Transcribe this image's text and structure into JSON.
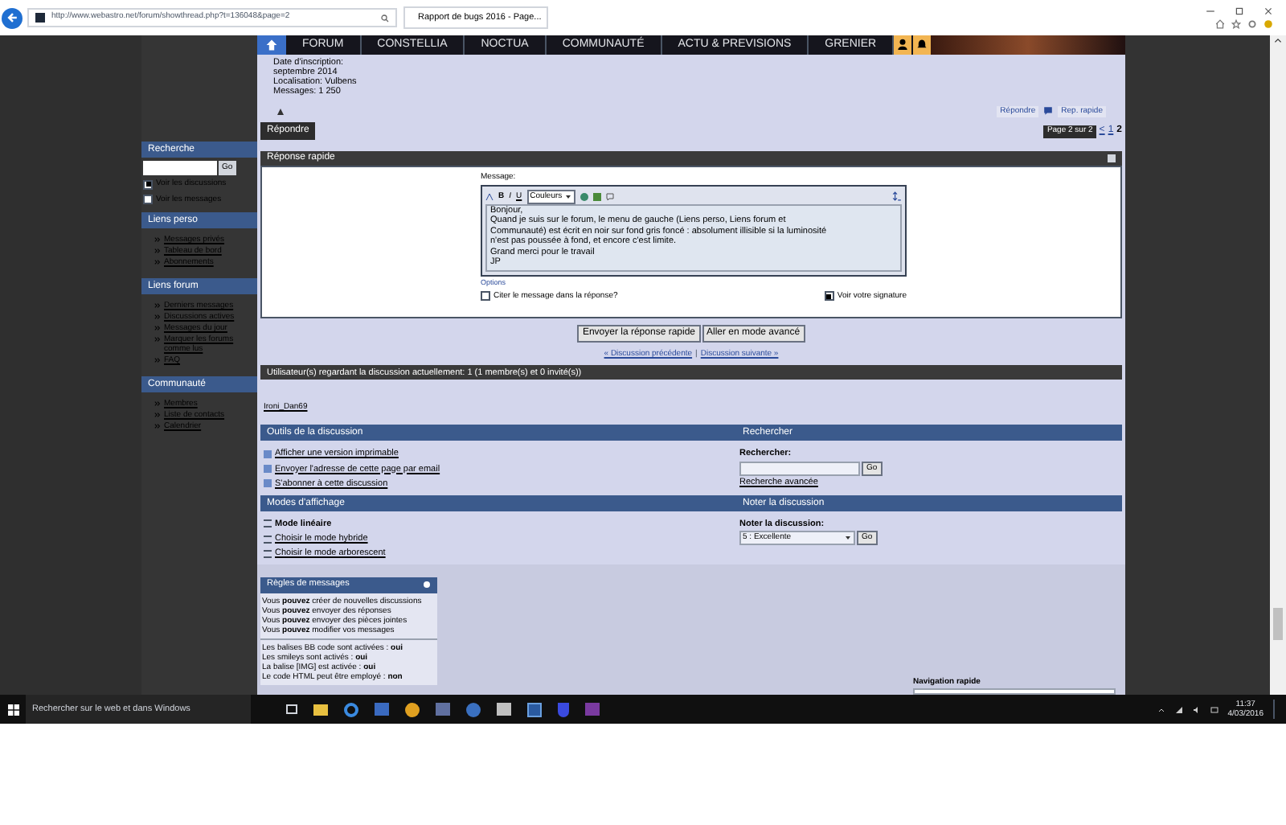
{
  "browser": {
    "url": "http://www.webastro.net/forum/showthread.php?t=136048&page=2",
    "tab_title": "Rapport de bugs 2016 - Page..."
  },
  "nav": {
    "items": [
      "FORUM",
      "CONSTELLIA",
      "NOCTUA",
      "COMMUNAUTÉ",
      "ACTU & PREVISIONS",
      "GRENIER"
    ]
  },
  "sidebar": {
    "search": {
      "title": "Recherche",
      "button": "Go",
      "options": [
        {
          "label": "Voir les discussions",
          "checked": true
        },
        {
          "label": "Voir les messages",
          "checked": false
        }
      ]
    },
    "sections": [
      {
        "title": "Liens perso",
        "items": [
          "Messages privés",
          "Tableau de bord",
          "Abonnements"
        ]
      },
      {
        "title": "Liens forum",
        "items": [
          "Derniers messages",
          "Discussions actives",
          "Messages du jour",
          "Marquer les forums comme lus",
          "FAQ"
        ]
      },
      {
        "title": "Communauté",
        "items": [
          "Membres",
          "Liste de contacts",
          "Calendrier"
        ]
      }
    ]
  },
  "profile": {
    "lines": [
      "Date d'inscription:",
      "septembre 2014",
      "Localisation: Vulbens",
      "Messages: 1 250"
    ]
  },
  "post_buttons": [
    "Répondre",
    "Rep. rapide"
  ],
  "reply_button": "Répondre",
  "pagination": {
    "label": "Page 2 sur 2",
    "links": [
      {
        "label": "<",
        "selected": false
      },
      {
        "label": "1",
        "selected": false
      },
      {
        "label": "2",
        "selected": true
      }
    ]
  },
  "quick_reply": {
    "title": "Réponse rapide",
    "message_label": "Message:",
    "color_select": "Couleurs",
    "text": [
      "Bonjour,",
      "Quand je suis sur le forum, le menu de gauche (Liens perso, Liens forum et",
      "Communauté) est écrit en noir sur fond gris foncé : absolument illisible si la luminosité",
      "n'est pas poussée à fond, et encore c'est limite.",
      "Grand merci pour le travail",
      "JP"
    ],
    "format_buttons": [
      "B",
      "I",
      "U"
    ],
    "options_label": "Options",
    "options": [
      {
        "label": "Citer le message dans la réponse?",
        "checked": false
      },
      {
        "label": "Voir votre signature",
        "checked": true
      }
    ],
    "buttons": [
      "Envoyer la réponse rapide",
      "Aller en mode avancé"
    ],
    "thread_nav": {
      "previous": "« Discussion précédente",
      "separator": "|",
      "next": "Discussion suivante »"
    }
  },
  "viewers": {
    "title": "Utilisateur(s) regardant la discussion actuellement: 1 (1 membre(s) et 0 invité(s))",
    "users": [
      "Ironi_Dan69"
    ]
  },
  "tools": {
    "title": "Outils de la discussion",
    "items": [
      "Afficher une version imprimable",
      "Envoyer l'adresse de cette page par email",
      "S'abonner à cette discussion"
    ]
  },
  "search": {
    "title": "Rechercher",
    "label": "Rechercher:",
    "button": "Go",
    "advanced": "Recherche avancée"
  },
  "display_modes": {
    "title": "Modes d'affichage",
    "items": [
      {
        "label": "Mode linéaire",
        "selected": true
      },
      {
        "label": "Choisir le mode hybride",
        "selected": false
      },
      {
        "label": "Choisir le mode arborescent",
        "selected": false
      }
    ]
  },
  "rating": {
    "title": "Noter la discussion",
    "label": "Noter la discussion:",
    "value": "5 : Excellente",
    "button": "Go"
  },
  "rules": {
    "title": "Règles de messages",
    "permissions": [
      "Vous **pouvez** créer de nouvelles discussions",
      "Vous **pouvez** envoyer des réponses",
      "Vous **pouvez** envoyer des pièces jointes",
      "Vous **pouvez** modifier vos messages"
    ],
    "settings": [
      "Les balises BB code sont activées : **oui**",
      "Les smileys sont activés : **oui**",
      "La balise [IMG] est activée : **oui**",
      "Le code HTML peut être employé : **non**"
    ]
  },
  "quick_nav": {
    "label": "Navigation rapide"
  },
  "taskbar": {
    "search_placeholder": "Rechercher sur le web et dans Windows",
    "time": "11:37",
    "date": "4/03/2016"
  }
}
